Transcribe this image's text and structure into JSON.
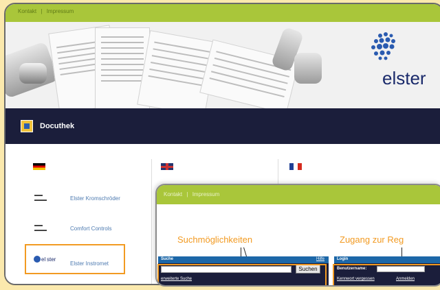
{
  "back": {
    "topbar_links": [
      "Kontakt",
      "|",
      "Impressum"
    ],
    "logo_text": "elster",
    "nav_title": "Docuthek",
    "columns": [
      {
        "flag": "de",
        "brands": [
          {
            "name": "Elster Kromschröder"
          },
          {
            "name": "Comfort Controls"
          },
          {
            "name": "Elster Instromet"
          }
        ]
      },
      {
        "flag": "uk"
      },
      {
        "flag": "fr"
      }
    ]
  },
  "front": {
    "topbar_links": [
      "Kontakt",
      "|",
      "Impressum"
    ],
    "annotation_search": "Suchmöglichkeiten",
    "annotation_login": "Zugang zur Reg",
    "search_panel": {
      "title": "Suche",
      "help": "Hilfe",
      "button": "Suchen",
      "advanced_link": "erweiterte Suche",
      "input_value": ""
    },
    "login_panel": {
      "title": "Login",
      "username_label": "Benutzername:",
      "username_value": "",
      "forgot_link": "Kennwort vergessen",
      "login_link": "Anmelden"
    }
  },
  "colors": {
    "accent_green": "#a9c63a",
    "nav_dark": "#1b1e3b",
    "highlight_orange": "#f29a21",
    "page_bg": "#fbe9ad"
  }
}
